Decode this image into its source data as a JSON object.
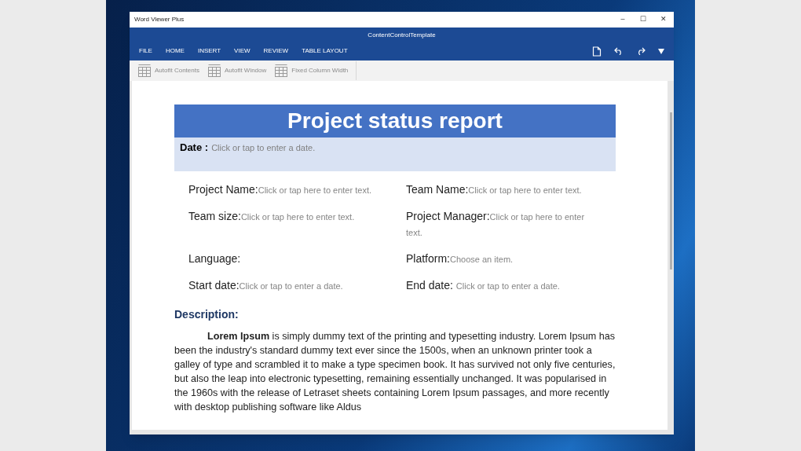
{
  "window": {
    "title": "Word Viewer Plus",
    "controls": [
      "–",
      "☐",
      "✕"
    ]
  },
  "document_title": "ContentControlTemplate",
  "menu": [
    {
      "label": "FILE"
    },
    {
      "label": "HOME"
    },
    {
      "label": "INSERT"
    },
    {
      "label": "VIEW"
    },
    {
      "label": "REVIEW"
    },
    {
      "label": "TABLE LAYOUT"
    }
  ],
  "ribbon": [
    {
      "label": "Autofit Contents",
      "disabled": true
    },
    {
      "label": "Autofit Window",
      "disabled": true
    },
    {
      "label": "Fixed Column Width",
      "disabled": true
    }
  ],
  "document": {
    "heading": "Project status report",
    "date": {
      "label": "Date :",
      "placeholder": "Click or tap to enter a date."
    },
    "fields": [
      {
        "label": "Project Name:",
        "placeholder": "Click or tap here to enter text."
      },
      {
        "label": "Team Name:",
        "placeholder": "Click or tap here to enter text."
      },
      {
        "label": "Team size:",
        "placeholder": "Click or tap here to enter text."
      },
      {
        "label": "Project Manager:",
        "placeholder": "Click or tap here to enter text."
      },
      {
        "label": "Language:"
      },
      {
        "label": "Platform:",
        "placeholder": "Choose an item."
      },
      {
        "label": "Start date:",
        "placeholder": "Click or tap to enter a date."
      },
      {
        "label": "End date: ",
        "placeholder": "Click or tap to enter a date."
      }
    ],
    "section_title": "Description:",
    "paragraph": "**Lorem Ipsum** is simply dummy text of the printing and typesetting industry. Lorem Ipsum has been the industry's standard dummy text ever since the 1500s, when an unknown printer took a galley of type and scrambled it to make a type specimen book. It has survived not only five centuries, but also the leap into electronic typesetting, remaining essentially unchanged. It was popularised in the 1960s with the release of Letraset sheets containing Lorem Ipsum passages, and more recently with desktop publishing software like Aldus"
  }
}
